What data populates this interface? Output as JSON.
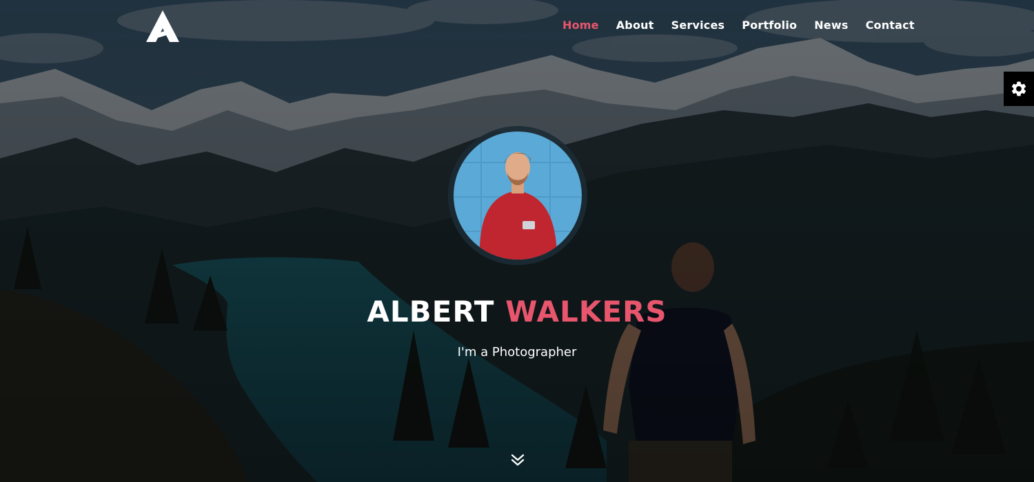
{
  "brand": {
    "logo_letter": "A",
    "accent_color": "#e8566d"
  },
  "nav": {
    "items": [
      {
        "label": "Home",
        "active": true
      },
      {
        "label": "About",
        "active": false
      },
      {
        "label": "Services",
        "active": false
      },
      {
        "label": "Portfolio",
        "active": false
      },
      {
        "label": "News",
        "active": false
      },
      {
        "label": "Contact",
        "active": false
      }
    ]
  },
  "hero": {
    "first_name": "ALBERT",
    "last_name": "WALKERS",
    "tagline": "I'm a Photographer"
  },
  "icons": {
    "settings": "gear-icon",
    "scroll": "chevron-double-down-icon"
  }
}
